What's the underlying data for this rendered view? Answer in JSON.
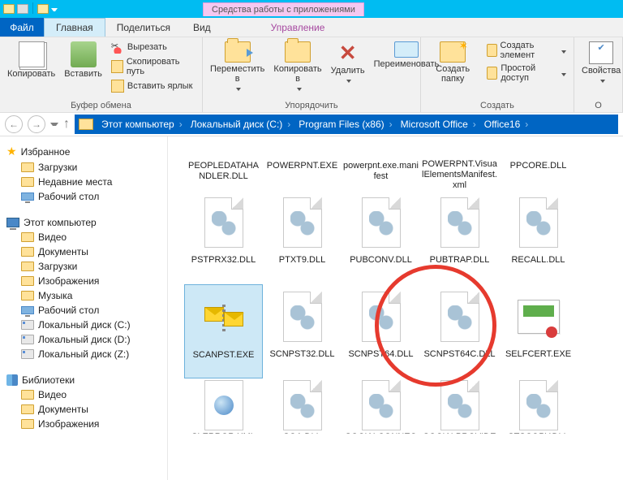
{
  "titlebar": {
    "context_title": "Средства работы с приложениями"
  },
  "tabs": {
    "file": "Файл",
    "home": "Главная",
    "share": "Поделиться",
    "view": "Вид",
    "manage": "Управление"
  },
  "ribbon": {
    "clipboard": {
      "copy": "Копировать",
      "paste": "Вставить",
      "cut": "Вырезать",
      "copy_path": "Скопировать путь",
      "paste_shortcut": "Вставить ярлык",
      "group": "Буфер обмена"
    },
    "organize": {
      "move": "Переместить в",
      "copy_to": "Копировать в",
      "delete": "Удалить",
      "rename": "Переименовать",
      "group": "Упорядочить"
    },
    "new": {
      "new_folder": "Создать папку",
      "new_item": "Создать элемент",
      "easy_access": "Простой доступ",
      "group": "Создать"
    },
    "open": {
      "properties": "Свойства",
      "group": "О"
    }
  },
  "breadcrumbs": [
    "Этот компьютер",
    "Локальный диск (C:)",
    "Program Files (x86)",
    "Microsoft Office",
    "Office16"
  ],
  "tree": {
    "favorites": {
      "label": "Избранное",
      "items": [
        "Загрузки",
        "Недавние места",
        "Рабочий стол"
      ]
    },
    "computer": {
      "label": "Этот компьютер",
      "items": [
        "Видео",
        "Документы",
        "Загрузки",
        "Изображения",
        "Музыка",
        "Рабочий стол",
        "Локальный диск (C:)",
        "Локальный диск (D:)",
        "Локальный диск (Z:)"
      ]
    },
    "libraries": {
      "label": "Библиотеки",
      "items": [
        "Видео",
        "Документы",
        "Изображения"
      ]
    }
  },
  "files": [
    {
      "name": "PEOPLEDATAHANDLER.DLL",
      "type": "trunc"
    },
    {
      "name": "POWERPNT.EXE",
      "type": "ppt-trunc"
    },
    {
      "name": "powerpnt.exe.manifest",
      "type": "txt-trunc"
    },
    {
      "name": "POWERPNT.VisualElementsManifest.xml",
      "type": "txt-trunc"
    },
    {
      "name": "PPCORE.DLL",
      "type": "trunc"
    },
    {
      "name": "PSTPRX32.DLL",
      "type": "dll"
    },
    {
      "name": "PTXT9.DLL",
      "type": "dll"
    },
    {
      "name": "PUBCONV.DLL",
      "type": "dll"
    },
    {
      "name": "PUBTRAP.DLL",
      "type": "dll"
    },
    {
      "name": "RECALL.DLL",
      "type": "dll"
    },
    {
      "name": "SCANPST.EXE",
      "type": "scanpst",
      "selected": true
    },
    {
      "name": "SCNPST32.DLL",
      "type": "dll"
    },
    {
      "name": "SCNPST64.DLL",
      "type": "dll"
    },
    {
      "name": "SCNPST64C.DLL",
      "type": "dll"
    },
    {
      "name": "SELFCERT.EXE",
      "type": "cert"
    },
    {
      "name": "SLERROR.XML",
      "type": "xml"
    },
    {
      "name": "SOA.DLL",
      "type": "dll"
    },
    {
      "name": "SOCIALCONNECTOR.DLL",
      "type": "dll"
    },
    {
      "name": "SOCIALPROVIDER.DLL",
      "type": "dll"
    },
    {
      "name": "STSCOPY.DLL",
      "type": "dll"
    }
  ]
}
